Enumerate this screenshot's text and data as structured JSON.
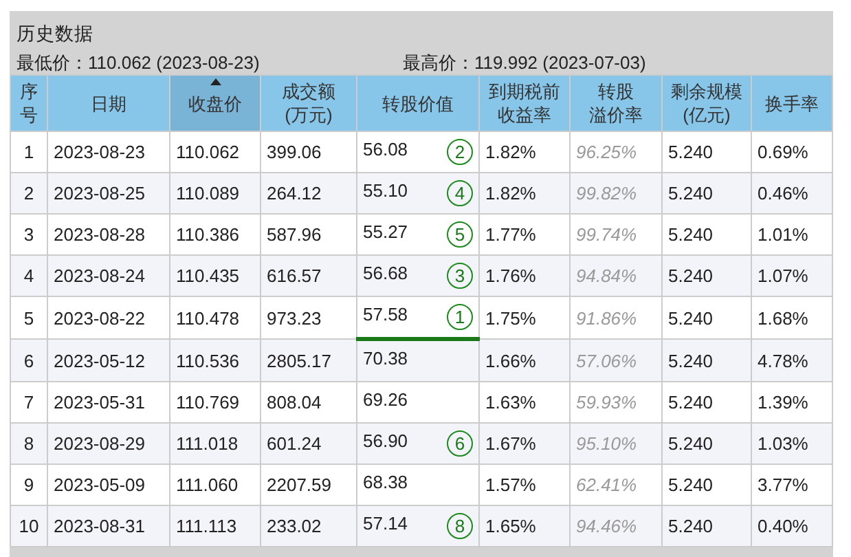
{
  "panel": {
    "title": "历史数据",
    "low": "最低价：110.062 (2023-08-23)",
    "high": "最高价：119.992 (2023-07-03)"
  },
  "table": {
    "columns": [
      {
        "lines": [
          "序",
          "号"
        ],
        "sorted": false
      },
      {
        "lines": [
          "日期"
        ],
        "sorted": false
      },
      {
        "lines": [
          "收盘价"
        ],
        "sorted": true
      },
      {
        "lines": [
          "成交额",
          "(万元)"
        ],
        "sorted": false
      },
      {
        "lines": [
          "转股价值"
        ],
        "sorted": false
      },
      {
        "lines": [
          "到期税前",
          "收益率"
        ],
        "sorted": false
      },
      {
        "lines": [
          "转股",
          "溢价率"
        ],
        "sorted": false
      },
      {
        "lines": [
          "剩余规模",
          "(亿元)"
        ],
        "sorted": false
      },
      {
        "lines": [
          "换手率"
        ],
        "sorted": false
      }
    ],
    "rows": [
      {
        "no": "1",
        "date": "2023-08-23",
        "close": "110.062",
        "amount": "399.06",
        "value": "56.08",
        "rank": "2",
        "highlight": false,
        "ytm": "1.82%",
        "premium": "96.25%",
        "size": "5.240",
        "turnover": "0.69%"
      },
      {
        "no": "2",
        "date": "2023-08-25",
        "close": "110.089",
        "amount": "264.12",
        "value": "55.10",
        "rank": "4",
        "highlight": false,
        "ytm": "1.82%",
        "premium": "99.82%",
        "size": "5.240",
        "turnover": "0.46%"
      },
      {
        "no": "3",
        "date": "2023-08-28",
        "close": "110.386",
        "amount": "587.96",
        "value": "55.27",
        "rank": "5",
        "highlight": false,
        "ytm": "1.77%",
        "premium": "99.74%",
        "size": "5.240",
        "turnover": "1.01%"
      },
      {
        "no": "4",
        "date": "2023-08-24",
        "close": "110.435",
        "amount": "616.57",
        "value": "56.68",
        "rank": "3",
        "highlight": false,
        "ytm": "1.76%",
        "premium": "94.84%",
        "size": "5.240",
        "turnover": "1.07%"
      },
      {
        "no": "5",
        "date": "2023-08-22",
        "close": "110.478",
        "amount": "973.23",
        "value": "57.58",
        "rank": "1",
        "highlight": true,
        "ytm": "1.75%",
        "premium": "91.86%",
        "size": "5.240",
        "turnover": "1.68%"
      },
      {
        "no": "6",
        "date": "2023-05-12",
        "close": "110.536",
        "amount": "2805.17",
        "value": "70.38",
        "highlight": false,
        "ytm": "1.66%",
        "premium": "57.06%",
        "size": "5.240",
        "turnover": "4.78%"
      },
      {
        "no": "7",
        "date": "2023-05-31",
        "close": "110.769",
        "amount": "808.04",
        "value": "69.26",
        "highlight": false,
        "ytm": "1.63%",
        "premium": "59.93%",
        "size": "5.240",
        "turnover": "1.39%"
      },
      {
        "no": "8",
        "date": "2023-08-29",
        "close": "111.018",
        "amount": "601.24",
        "value": "56.90",
        "rank": "6",
        "highlight": false,
        "ytm": "1.67%",
        "premium": "95.10%",
        "size": "5.240",
        "turnover": "1.03%"
      },
      {
        "no": "9",
        "date": "2023-05-09",
        "close": "111.060",
        "amount": "2207.59",
        "value": "68.38",
        "highlight": false,
        "ytm": "1.57%",
        "premium": "62.41%",
        "size": "5.240",
        "turnover": "3.77%"
      },
      {
        "no": "10",
        "date": "2023-08-31",
        "close": "111.113",
        "amount": "233.02",
        "value": "57.14",
        "rank": "8",
        "highlight": false,
        "ytm": "1.65%",
        "premium": "94.46%",
        "size": "5.240",
        "turnover": "0.40%"
      }
    ]
  }
}
